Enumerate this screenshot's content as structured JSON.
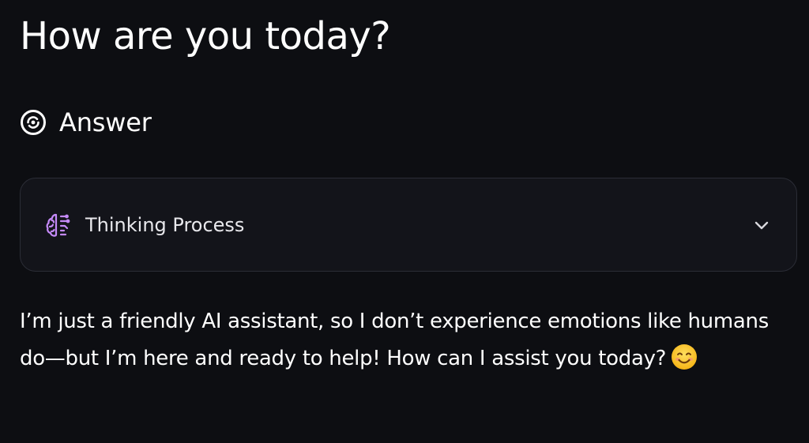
{
  "question": {
    "title": "How are you today?"
  },
  "answer": {
    "label": "Answer",
    "icon": "answer-spiral-icon"
  },
  "thinking": {
    "label": "Thinking Process",
    "icon": "brain-icon",
    "icon_color": "#c58af9",
    "expand_icon": "chevron-down-icon",
    "expanded": false
  },
  "response": {
    "text": "I’m just a friendly AI assistant, so I don’t experience emotions like humans do—but I’m here and ready to help! How can I assist you today?",
    "emoji": "smiling-face-emoji"
  },
  "colors": {
    "background": "#0d0e12",
    "card_background": "#13141a",
    "card_border": "#2b2d36",
    "text": "#ffffff"
  }
}
